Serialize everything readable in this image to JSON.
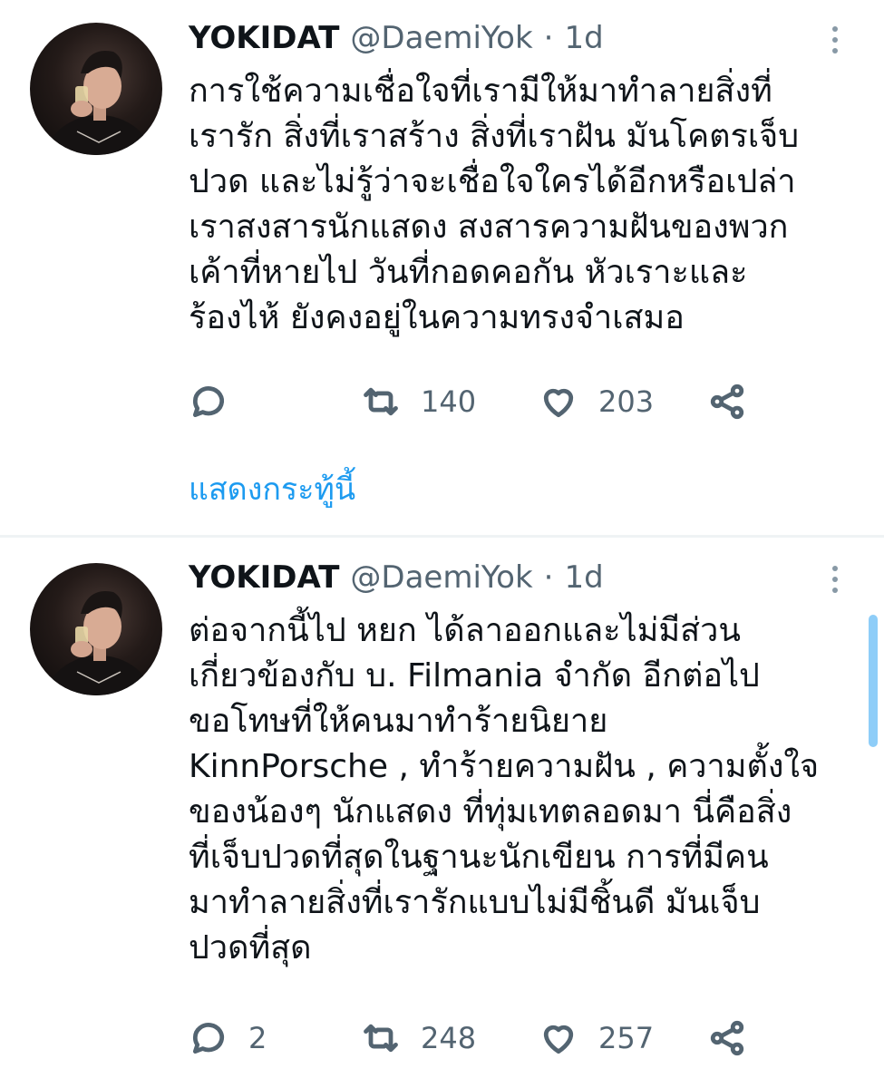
{
  "tweets": [
    {
      "author_name": "YOKIDAT",
      "handle": "@DaemiYok",
      "separator": "·",
      "time": "1d",
      "lines": [
        "การใช้ความเชื่อใจที่เรามีให้มาทำลายสิ่งที่",
        "เรารัก สิ่งที่เราสร้าง สิ่งที่เราฝัน มันโคตรเจ็บ",
        "ปวด และไม่รู้ว่าจะเชื่อใจใครได้อีกหรือเปล่า",
        "เราสงสารนักแสดง สงสารความฝันของพวก",
        "เค้าที่หายไป วันที่กอดคอกัน หัวเราะและ",
        "ร้องไห้ ยังคงอยู่ในความทรงจำเสมอ"
      ],
      "reply_count": "",
      "retweet_count": "140",
      "like_count": "203",
      "show_thread": "แสดงกระทู้นี้"
    },
    {
      "author_name": "YOKIDAT",
      "handle": "@DaemiYok",
      "separator": "·",
      "time": "1d",
      "lines": [
        "ต่อจากนี้ไป หยก ได้ลาออกและไม่มีส่วน",
        "เกี่ยวข้องกับ บ. Filmania จำกัด อีกต่อไป",
        "ขอโทษที่ให้คนมาทำร้ายนิยาย",
        "KinnPorsche , ทำร้ายความฝัน , ความตั้งใจ",
        "ของน้องๆ นักแสดง ที่ทุ่มเทตลอดมา นี่คือสิ่ง",
        "ที่เจ็บปวดที่สุดในฐานะนักเขียน การที่มีคน",
        "มาทำลายสิ่งที่เรารักแบบไม่มีชิ้นดี มันเจ็บ",
        "ปวดที่สุด"
      ],
      "reply_count": "2",
      "retweet_count": "248",
      "like_count": "257"
    }
  ],
  "icons": {
    "reply": "reply-icon",
    "retweet": "retweet-icon",
    "like": "heart-icon",
    "share": "share-icon",
    "more": "more-vertical-icon"
  },
  "colors": {
    "link": "#1d9bf0",
    "secondary_text": "#536471",
    "scrollbar": "#8ecdf8"
  }
}
